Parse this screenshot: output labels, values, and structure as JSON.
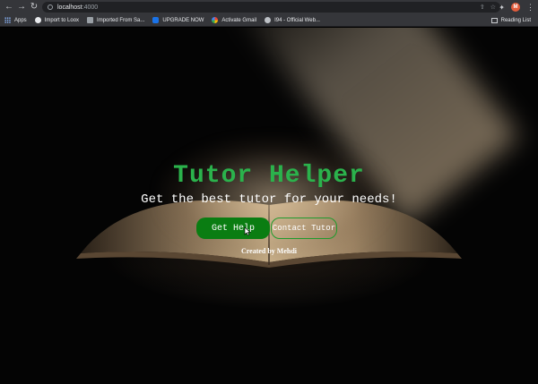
{
  "browser": {
    "url_host": "localhost",
    "url_port": ":4000",
    "avatar_letter": "M"
  },
  "bookmarks": [
    {
      "label": "Apps",
      "icon": "apps-grid-icon"
    },
    {
      "label": "Import to Loox",
      "icon": "loox-icon"
    },
    {
      "label": "Imported From Sa...",
      "icon": "folder-icon"
    },
    {
      "label": "UPGRADE NOW",
      "icon": "upgrade-icon"
    },
    {
      "label": "Activate Gmail",
      "icon": "google-icon"
    },
    {
      "label": "I94 - Official Web...",
      "icon": "globe-icon"
    }
  ],
  "reading_list": "Reading List",
  "hero": {
    "title": "Tutor Helper",
    "subtitle": "Get the best tutor for your needs!",
    "primary_button": "Get Help",
    "secondary_button": "Contact Tutor",
    "credit": "Created by Mehdi"
  },
  "colors": {
    "title": "#2bb24c",
    "primary_button": "#0a7d12",
    "secondary_border": "#1f9b2d"
  }
}
